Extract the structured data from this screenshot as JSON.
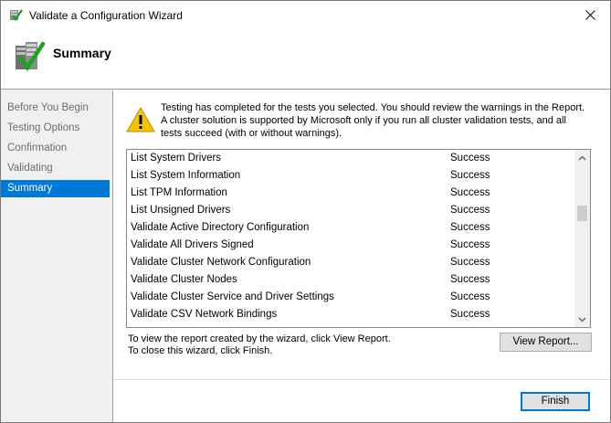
{
  "window": {
    "title": "Validate a Configuration Wizard"
  },
  "header": {
    "title": "Summary"
  },
  "nav": {
    "items": [
      {
        "label": "Before You Begin",
        "active": false
      },
      {
        "label": "Testing Options",
        "active": false
      },
      {
        "label": "Confirmation",
        "active": false
      },
      {
        "label": "Validating",
        "active": false
      },
      {
        "label": "Summary",
        "active": true
      }
    ]
  },
  "content": {
    "message": "Testing has completed for the tests you selected. You should review the warnings in the Report.  A cluster solution is supported by Microsoft only if you run all cluster validation tests, and all tests succeed (with or without warnings).",
    "results": [
      {
        "name": "List System Drivers",
        "status": "Success"
      },
      {
        "name": "List System Information",
        "status": "Success"
      },
      {
        "name": "List TPM Information",
        "status": "Success"
      },
      {
        "name": "List Unsigned Drivers",
        "status": "Success"
      },
      {
        "name": "Validate Active Directory Configuration",
        "status": "Success"
      },
      {
        "name": "Validate All Drivers Signed",
        "status": "Success"
      },
      {
        "name": "Validate Cluster Network Configuration",
        "status": "Success"
      },
      {
        "name": "Validate Cluster Nodes",
        "status": "Success"
      },
      {
        "name": "Validate Cluster Service and Driver Settings",
        "status": "Success"
      },
      {
        "name": "Validate CSV Network Bindings",
        "status": "Success"
      }
    ],
    "info_line1": "To view the report created by the wizard, click View Report.",
    "info_line2": "To close this wizard, click Finish.",
    "view_report_label": "View Report...",
    "finish_label": "Finish"
  },
  "colors": {
    "accent": "#0078d7",
    "warning": "#f5c400"
  },
  "icons": {
    "title": "cluster-check-icon",
    "header": "cluster-check-icon",
    "warning": "warning-icon",
    "close": "close-icon"
  }
}
